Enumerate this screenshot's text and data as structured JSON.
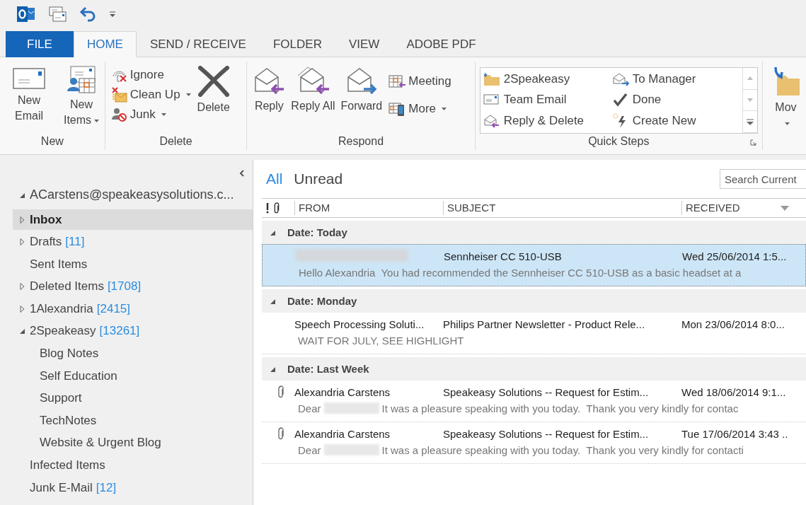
{
  "ribbon_tabs": [
    {
      "label": "FILE",
      "kind": "file",
      "selected": false
    },
    {
      "label": "HOME",
      "kind": "tab",
      "selected": true
    },
    {
      "label": "SEND / RECEIVE",
      "kind": "tab",
      "selected": false
    },
    {
      "label": "FOLDER",
      "kind": "tab",
      "selected": false
    },
    {
      "label": "VIEW",
      "kind": "tab",
      "selected": false
    },
    {
      "label": "ADOBE PDF",
      "kind": "tab",
      "selected": false
    }
  ],
  "ribbon": {
    "new": {
      "title": "New",
      "new_email": {
        "label": "New Email"
      },
      "new_items": {
        "label": "New Items",
        "dropdown": true
      }
    },
    "delete": {
      "title": "Delete",
      "ignore": {
        "label": "Ignore"
      },
      "clean_up": {
        "label": "Clean Up",
        "dropdown": true
      },
      "junk": {
        "label": "Junk",
        "dropdown": true
      },
      "delete": {
        "label": "Delete"
      }
    },
    "respond": {
      "title": "Respond",
      "reply": {
        "label": "Reply"
      },
      "reply_all": {
        "label": "Reply All"
      },
      "forward": {
        "label": "Forward"
      },
      "meeting": {
        "label": "Meeting"
      },
      "more": {
        "label": "More",
        "dropdown": true
      }
    },
    "quick_steps": {
      "title": "Quick Steps",
      "items": [
        {
          "label": "2Speakeasy"
        },
        {
          "label": "To Manager"
        },
        {
          "label": "Team Email"
        },
        {
          "label": "Done"
        },
        {
          "label": "Reply & Delete"
        },
        {
          "label": "Create New"
        }
      ]
    },
    "move": {
      "label": "Mov",
      "dropdown": true
    }
  },
  "account": {
    "label": "ACarstens@speakeasysolutions.c...",
    "expanded": true
  },
  "folders": [
    {
      "label": "Inbox",
      "expanded": false,
      "selected": true
    },
    {
      "label": "Drafts",
      "count": "[11]",
      "expanded": false,
      "selected": false
    },
    {
      "label": "Sent Items",
      "selected": false
    },
    {
      "label": "Deleted Items",
      "count": "[1708]",
      "expanded": false,
      "selected": false
    },
    {
      "label": "1Alexandria",
      "count": "[2415]",
      "expanded": false,
      "selected": false
    },
    {
      "label": "2Speakeasy",
      "count": "[13261]",
      "expanded": true,
      "selected": false,
      "children": [
        {
          "label": "Blog Notes",
          "selected": false
        },
        {
          "label": "Self Education",
          "selected": false
        },
        {
          "label": "Support",
          "selected": false
        },
        {
          "label": "TechNotes",
          "selected": false
        },
        {
          "label": "Website & Urgent Blog",
          "selected": false
        }
      ]
    },
    {
      "label": "Infected Items",
      "selected": false
    },
    {
      "label": "Junk E-Mail",
      "count": "[12]",
      "selected": false
    }
  ],
  "filters": [
    {
      "label": "All",
      "selected": true
    },
    {
      "label": "Unread",
      "selected": false
    }
  ],
  "search": {
    "placeholder": "Search Current"
  },
  "columns": {
    "from": "FROM",
    "subject": "SUBJECT",
    "received": "RECEIVED"
  },
  "message_groups": [
    {
      "title": "Date: Today",
      "expanded": true,
      "rows": [
        {
          "from_redacted": true,
          "subject": "Sennheiser CC 510-USB",
          "received": "Wed 25/06/2014 1:5...",
          "preview": "Hello Alexandria  You had recommended the Sennheiser CC 510-USB as a basic headset at a",
          "selected": true,
          "attachment": false
        }
      ]
    },
    {
      "title": "Date: Monday",
      "expanded": true,
      "rows": [
        {
          "from_redacted": false,
          "from": "Speech Processing Soluti...",
          "subject": "Philips Partner Newsletter - Product Rele...",
          "received": "Mon 23/06/2014 8:0...",
          "preview": "WAIT FOR JULY, SEE HIGHLIGHT",
          "selected": false,
          "attachment": false
        }
      ]
    },
    {
      "title": "Date: Last Week",
      "expanded": true,
      "rows": [
        {
          "from_redacted": false,
          "from": "Alexandria Carstens",
          "subject": "Speakeasy Solutions -- Request for Estim...",
          "received": "Wed 18/06/2014 9:1...",
          "preview_lead": "Dear",
          "preview": "It was a pleasure speaking with you today.  Thank you very kindly for contac",
          "selected": false,
          "attachment": true
        },
        {
          "from_redacted": false,
          "from": "Alexandria Carstens",
          "subject": "Speakeasy Solutions -- Request for Estim...",
          "received": "Tue 17/06/2014 3:43 ..",
          "preview_lead": "Dear",
          "preview": "It was a pleasure speaking with you today.  Thank you very kindly for contacti",
          "selected": false,
          "attachment": true
        }
      ]
    }
  ]
}
